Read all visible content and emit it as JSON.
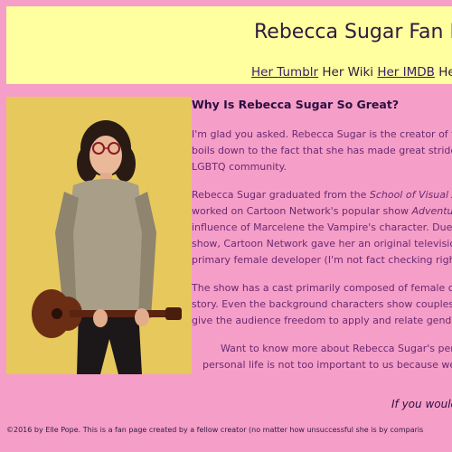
{
  "header": {
    "title": "Rebecca Sugar Fan P",
    "nav": {
      "tumblr": "Her Tumblr",
      "wiki": "Her Wiki",
      "imdb": "Her IMDB",
      "more": "He"
    }
  },
  "main": {
    "heading": "Why Is Rebecca Sugar So Great?",
    "p1": {
      "line1": "I'm glad you asked. Rebecca Sugar is the creator of the",
      "line2": "boils down to the fact that she has made great strides",
      "line3": "LGBTQ community."
    },
    "p2": {
      "line1a": "Rebecca Sugar graduated from the ",
      "line1b": "School of Visual Ar",
      "line2a": "worked on Cartoon Network's popular show ",
      "line2b": "Adventure",
      "line3": "influence of Marcelene the Vampire's character. Due to",
      "line4": "show, Cartoon Network gave her an original television",
      "line5": "primary female developer (I'm not fact checking right n"
    },
    "p3": {
      "line1": "The show has a cast primarily composed of female cha",
      "line2": "story. Even the background characters show couples in",
      "line3": "give the audience freedom to apply and relate gender."
    },
    "p4": {
      "line1": "Want to know more about Rebecca Sugar's perso",
      "line2": "personal life is not too important to us because we a"
    },
    "closing": "If you would"
  },
  "footer": {
    "text": "©2016 by Elle Pope. This is a fan page created by a fellow creator (no matter how unsuccessful she is by comparis"
  },
  "colors": {
    "page_bg": "#f59ec8",
    "header_bg": "#ffff9f",
    "link": "#3a1d6a",
    "body_text": "#6a2a70"
  }
}
